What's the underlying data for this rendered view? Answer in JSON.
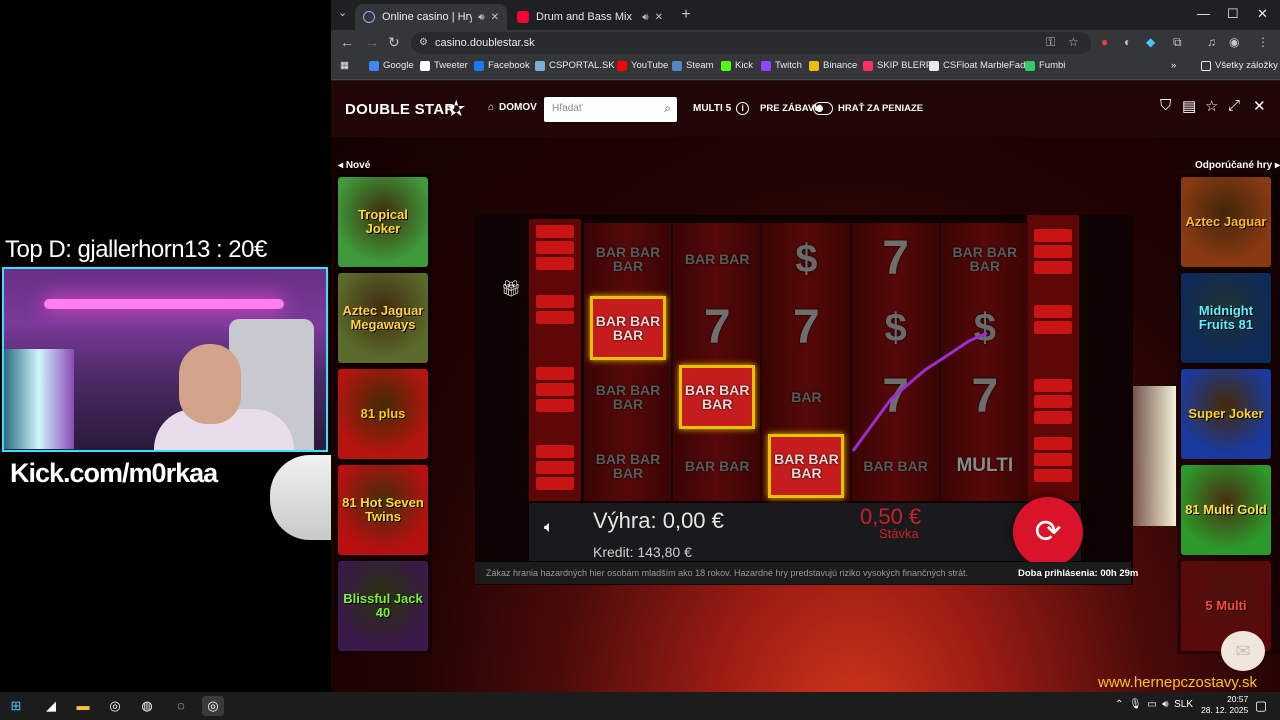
{
  "overlay": {
    "top_donor": "Top D: gjallerhorn13 : 20€",
    "kick_handle": "Kick.com/m0rkaa",
    "watermark": "www.hernepczostavy.sk"
  },
  "browser": {
    "tabs": [
      {
        "title": "Online casino | Hry, bonusy",
        "favicon_color": "#8ab4f8"
      },
      {
        "title": "Drum and Bass Mix | Week",
        "favicon_color": "#ff0033"
      }
    ],
    "address": "casino.doublestar.sk",
    "bookmarks": [
      {
        "label": "Google",
        "color": "#4285f4"
      },
      {
        "label": "Tweeter",
        "color": "#ffffff"
      },
      {
        "label": "Facebook",
        "color": "#1877f2"
      },
      {
        "label": "CSPORTAL.SK :)",
        "color": "#7ab0d4"
      },
      {
        "label": "YouTube",
        "color": "#ff0000"
      },
      {
        "label": "Steam",
        "color": "#4f86c6"
      },
      {
        "label": "Kick",
        "color": "#53fc18"
      },
      {
        "label": "Twitch",
        "color": "#9146ff"
      },
      {
        "label": "Binance",
        "color": "#f0b90b"
      },
      {
        "label": "SKIP BLERP",
        "color": "#ff2e63"
      },
      {
        "label": "CSFloat MarbleFade",
        "color": "#e8eaed"
      },
      {
        "label": "Fumbi",
        "color": "#33cc66"
      }
    ],
    "all_bookmarks": "Všetky záložky"
  },
  "site": {
    "logo": "DOUBLE STAR",
    "home": "DOMOV",
    "search_placeholder": "Hľadať",
    "multi": "MULTI 5",
    "for_fun": "PRE ZÁBAVU",
    "for_money": "HRAŤ ZA PENIAZE",
    "new_label": "Nové",
    "recommended_label": "Odporúčané hry",
    "new_games": [
      {
        "name": "Tropical Joker",
        "bg": "#3f9a3a",
        "fg": "#ffd83a"
      },
      {
        "name": "Aztec Jaguar Megaways",
        "bg": "#5a6a2a",
        "fg": "#ffd24a"
      },
      {
        "name": "81 plus",
        "bg": "#b5150f",
        "fg": "#ffd000"
      },
      {
        "name": "81 Hot Seven Twins",
        "bg": "#b81010",
        "fg": "#ffde2a"
      },
      {
        "name": "Blissful Jack 40",
        "bg": "#3a1a4a",
        "fg": "#7cf23c"
      }
    ],
    "recommended_games": [
      {
        "name": "Aztec Jaguar",
        "bg": "#8a3a12",
        "fg": "#ffb92a"
      },
      {
        "name": "Midnight Fruits 81",
        "bg": "#0e2a5a",
        "fg": "#5cf2ff"
      },
      {
        "name": "Super Joker",
        "bg": "#1a3aa0",
        "fg": "#ffd21a"
      },
      {
        "name": "81 Multi Gold",
        "bg": "#2c9a2a",
        "fg": "#ffe04a"
      },
      {
        "name": "5 Multi",
        "bg": "#5a0a0a",
        "fg": "#ff4a3a"
      }
    ]
  },
  "game": {
    "reels": [
      [
        "BAR BAR BAR",
        "BAR BAR BAR",
        "BAR BAR BAR",
        "BAR BAR BAR"
      ],
      [
        "BAR BAR",
        "7",
        "BAR BAR BAR",
        "BAR BAR"
      ],
      [
        "$",
        "7",
        "BAR",
        "BAR BAR BAR"
      ],
      [
        "7",
        "$",
        "7",
        "BAR BAR"
      ],
      [
        "BAR BAR BAR",
        "$",
        "7",
        "MULTI"
      ]
    ],
    "win_label": "Výhra:",
    "win_value": "0,00 €",
    "credit_label": "Kredit:",
    "credit_value": "143,80 €",
    "stake_value": "0,50 €",
    "stake_label": "Stávka",
    "warning": "Zákaz hrania hazardných hier osobám mladším ako 18 rokov. Hazardné hry predstavujú riziko vysokých finančných strát.",
    "session": "Doba prihlásenia: 00h 29m"
  },
  "taskbar": {
    "lang": "SLK",
    "time": "20:57",
    "date": "28. 12. 2025"
  }
}
